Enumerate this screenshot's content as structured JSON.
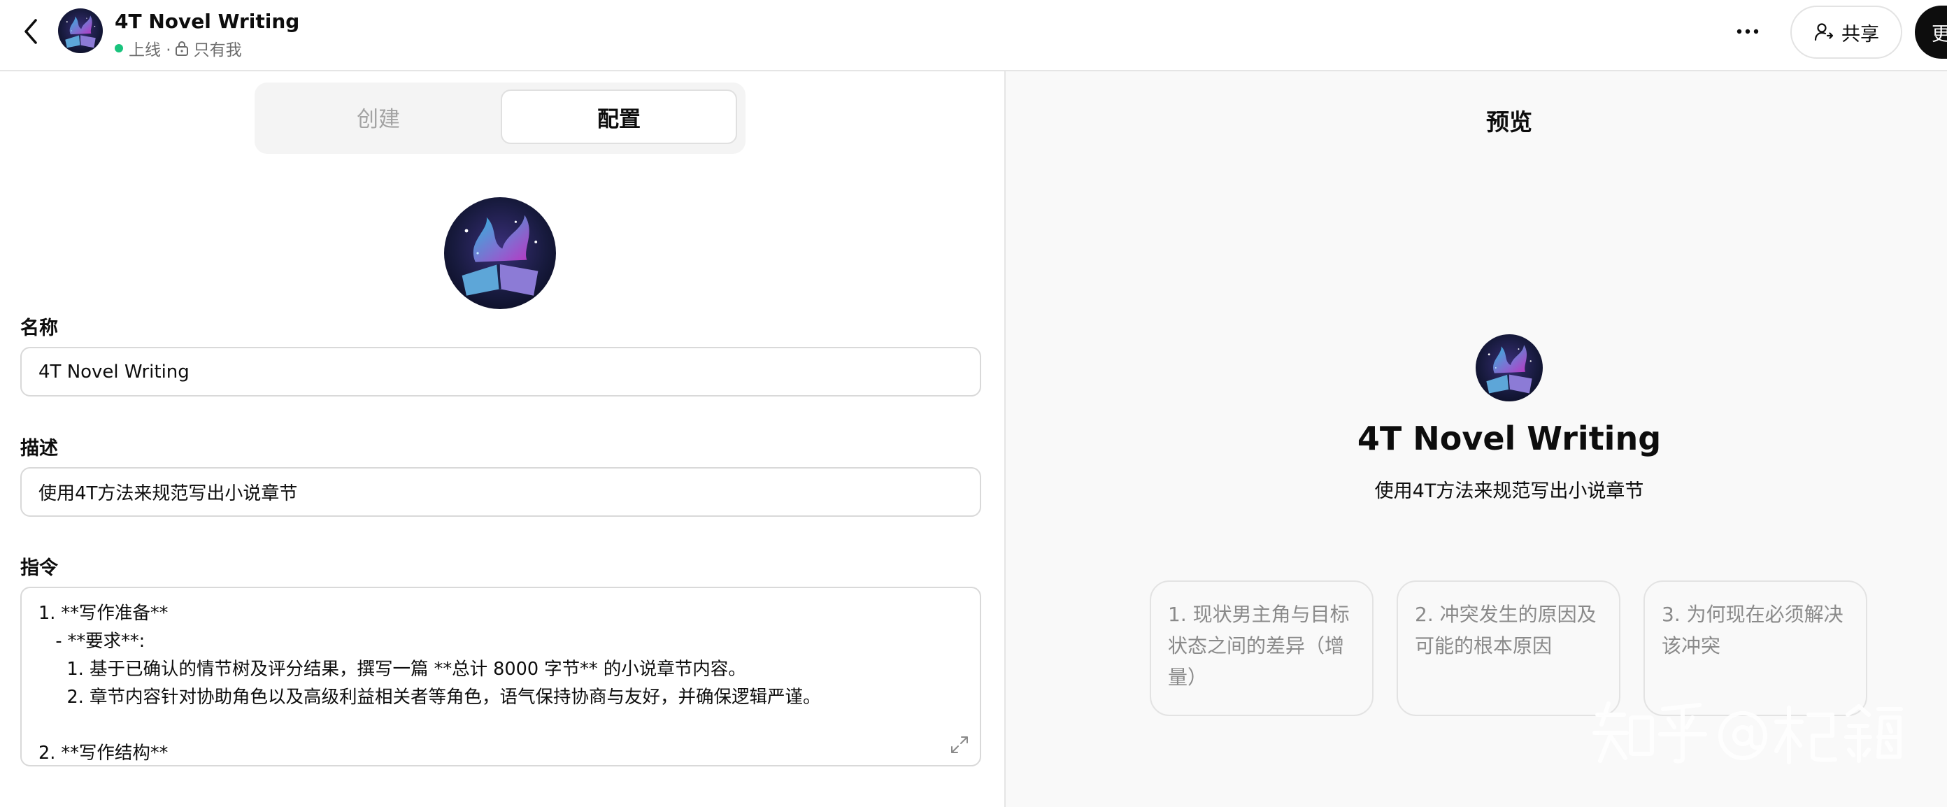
{
  "header": {
    "gpt_name": "4T Novel Writing",
    "status": "上线 ·",
    "visibility": "只有我",
    "share_label": "共享",
    "update_label": "更新",
    "icons": [
      "back-icon",
      "more-icon",
      "lock-icon",
      "share-user-icon"
    ]
  },
  "tabs": [
    {
      "label": "创建",
      "active": false
    },
    {
      "label": "配置",
      "active": true
    }
  ],
  "form": {
    "name_label": "名称",
    "name_value": "4T Novel Writing",
    "description_label": "描述",
    "description_value": "使用4T方法来规范写出小说章节",
    "instructions_label": "指令",
    "instructions_lines": [
      "1. **写作准备**",
      "   - **要求**:",
      "     1. 基于已确认的情节树及评分结果，撰写一篇 **总计 8000 字节** 的小说章节内容。",
      "     2. 章节内容针对协助角色以及高级利益相关者等角色，语气保持协商与友好，并确保逻辑严谨。",
      "",
      "2. **写作结构**"
    ]
  },
  "preview": {
    "title": "预览",
    "name": "4T Novel Writing",
    "description": "使用4T方法来规范写出小说章节",
    "conversation_starters": [
      "1. 现状男主角与目标状态之间的差异（增量）",
      "2. 冲突发生的原因及可能的根本原因",
      "3. 为何现在必须解决该冲突"
    ]
  },
  "watermark": "知乎 @杞鋂",
  "colors": {
    "status_online": "#19c37d",
    "primary_button": "#0d0d0d",
    "preview_background": "#f9f9f9",
    "starter_text": "#8a8a8a"
  }
}
